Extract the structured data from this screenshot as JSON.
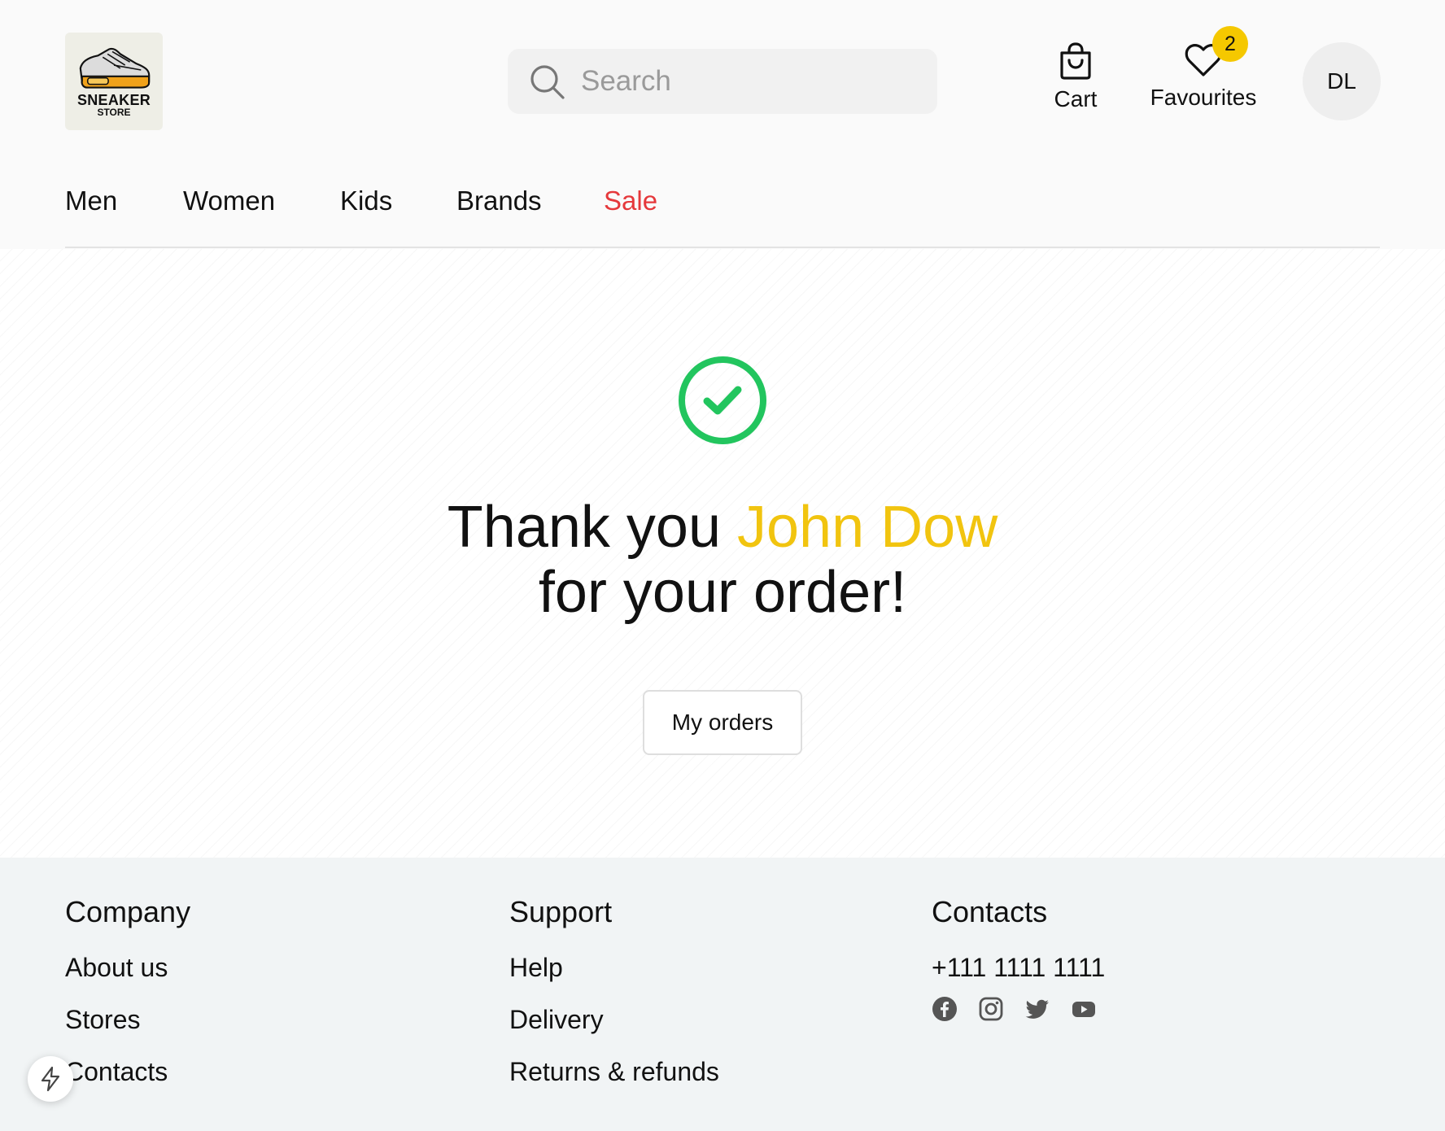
{
  "header": {
    "logo": {
      "word": "SNEAKER",
      "sub": "STORE"
    },
    "search": {
      "placeholder": "Search",
      "value": ""
    },
    "cart_label": "Cart",
    "favourites_label": "Favourites",
    "favourites_count": "2",
    "avatar_initials": "DL"
  },
  "nav": {
    "items": [
      {
        "label": "Men"
      },
      {
        "label": "Women"
      },
      {
        "label": "Kids"
      },
      {
        "label": "Brands"
      },
      {
        "label": "Sale"
      }
    ]
  },
  "confirmation": {
    "prefix": "Thank you",
    "name": "John Dow",
    "line2": "for your order!",
    "button_label": "My orders"
  },
  "footer": {
    "company": {
      "title": "Company",
      "links": [
        "About us",
        "Stores",
        "Contacts"
      ]
    },
    "support": {
      "title": "Support",
      "links": [
        "Help",
        "Delivery",
        "Returns & refunds"
      ]
    },
    "contacts": {
      "title": "Contacts",
      "phone": "+111 1111 1111",
      "socials": [
        "facebook-icon",
        "instagram-icon",
        "twitter-icon",
        "youtube-icon"
      ]
    }
  },
  "colors": {
    "accent_yellow": "#f1c40f",
    "sale_red": "#e5383b",
    "success_green": "#22c55e",
    "footer_bg": "#f1f4f5"
  }
}
